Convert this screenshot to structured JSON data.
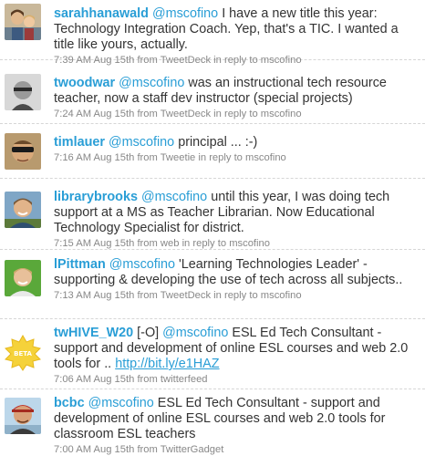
{
  "tweets": [
    {
      "username": "sarahhanawald",
      "mention": "@mscofino",
      "text": "I have a new title this year: Technology Integration Coach. Yep, that's a TIC. I wanted a title like yours, actually.",
      "time": "7:39 AM Aug 15th",
      "from_label": "from",
      "source": "TweetDeck",
      "reply_label": "in reply to",
      "reply_to": "mscofino"
    },
    {
      "username": "twoodwar",
      "mention": "@mscofino",
      "text": "was an instructional tech resource teacher, now a staff dev instructor (special projects)",
      "time": "7:24 AM Aug 15th",
      "from_label": "from",
      "source": "TweetDeck",
      "reply_label": "in reply to",
      "reply_to": "mscofino"
    },
    {
      "username": "timlauer",
      "mention": "@mscofino",
      "text": "principal ... :-)",
      "time": "7:16 AM Aug 15th",
      "from_label": "from",
      "source": "Tweetie",
      "reply_label": "in reply to",
      "reply_to": "mscofino"
    },
    {
      "username": "librarybrooks",
      "mention": "@mscofino",
      "text": "until this year, I was doing tech support at a MS as Teacher Librarian. Now Educational Technology Specialist for district.",
      "time": "7:15 AM Aug 15th",
      "from_label": "from",
      "source": "web",
      "reply_label": "in reply to",
      "reply_to": "mscofino"
    },
    {
      "username": "lPittman",
      "mention": "@mscofino",
      "text": "'Learning Technologies Leader' - supporting & developing the use of tech across all subjects..",
      "time": "7:13 AM Aug 15th",
      "from_label": "from",
      "source": "TweetDeck",
      "reply_label": "in reply to",
      "reply_to": "mscofino"
    },
    {
      "username": "twHIVE_W20",
      "prefix": "[-O]",
      "mention": "@mscofino",
      "text": "ESL Ed Tech Consultant - support and development of online ESL courses and web 2.0 tools for ..",
      "link": "http://bit.ly/e1HAZ",
      "avatar_badge": "BETA",
      "time": "7:06 AM Aug 15th",
      "from_label": "from",
      "source": "twitterfeed"
    },
    {
      "username": "bcbc",
      "mention": "@mscofino",
      "text": "ESL Ed Tech Consultant - support and development of online ESL courses and web 2.0 tools for classroom ESL teachers",
      "time": "7:00 AM Aug 15th",
      "from_label": "from",
      "source": "TwitterGadget"
    }
  ],
  "colors": {
    "link": "#2a9ed6",
    "meta": "#888888",
    "text": "#333333"
  }
}
